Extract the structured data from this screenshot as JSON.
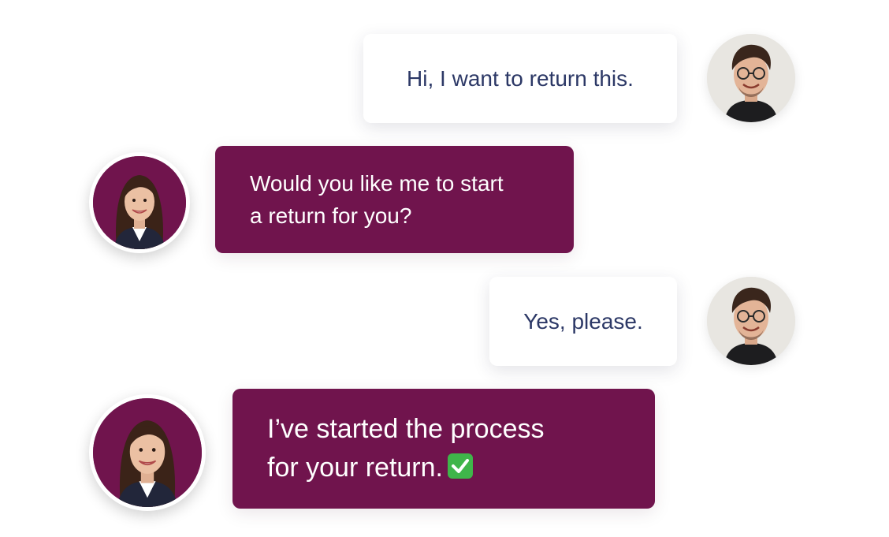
{
  "messages": [
    {
      "role": "customer",
      "lines": [
        "Hi, I want to return this."
      ]
    },
    {
      "role": "agent",
      "lines": [
        "Would you like me to start",
        "a return for you?"
      ]
    },
    {
      "role": "customer",
      "lines": [
        "Yes, please."
      ]
    },
    {
      "role": "agent",
      "lines": [
        "I’ve started the process",
        "for your return."
      ],
      "emoji": "check-mark-icon"
    }
  ],
  "colors": {
    "agent_bubble": "#70144d",
    "agent_text": "#ffffff",
    "customer_bubble": "#ffffff",
    "customer_text": "#2c3866",
    "check_badge": "#3fb54a"
  },
  "avatars": {
    "customer": "man-avatar",
    "agent": "woman-avatar"
  }
}
